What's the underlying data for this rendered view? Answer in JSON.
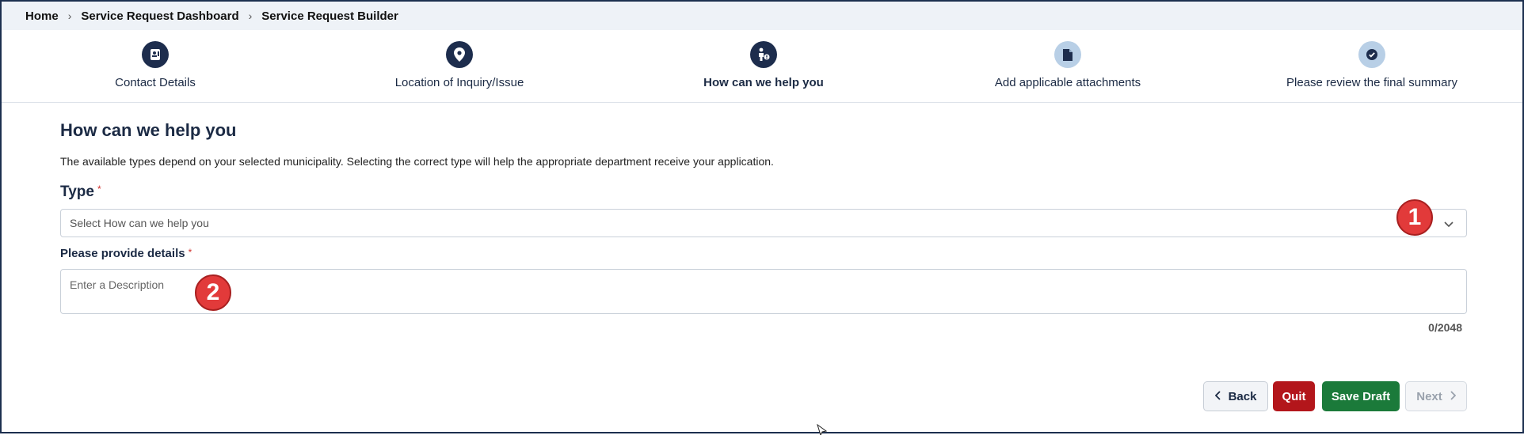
{
  "breadcrumb": {
    "items": [
      "Home",
      "Service Request Dashboard",
      "Service Request Builder"
    ]
  },
  "stepper": {
    "steps": [
      {
        "label": "Contact Details",
        "icon": "contact-card-icon",
        "state": "complete"
      },
      {
        "label": "Location of Inquiry/Issue",
        "icon": "map-pin-icon",
        "state": "complete"
      },
      {
        "label": "How can we help you",
        "icon": "person-help-icon",
        "state": "active"
      },
      {
        "label": "Add applicable attachments",
        "icon": "document-icon",
        "state": "pending"
      },
      {
        "label": "Please review the final summary",
        "icon": "check-circle-icon",
        "state": "pending"
      }
    ]
  },
  "form": {
    "heading": "How can we help you",
    "description": "The available types depend on your selected municipality. Selecting the correct type will help the appropriate department receive your application.",
    "type_label": "Type",
    "type_placeholder": "Select How can we help you",
    "details_label": "Please provide details",
    "details_placeholder": "Enter a Description",
    "required_mark": "*",
    "counter": "0/2048"
  },
  "markers": [
    "1",
    "2"
  ],
  "buttons": {
    "back": "Back",
    "quit": "Quit",
    "save_draft": "Save Draft",
    "next": "Next"
  },
  "colors": {
    "primary_dark": "#1d2d4d",
    "step_pending": "#b8cfe6",
    "quit": "#b3161b",
    "save": "#1b7a3a",
    "marker": "#e23a3a"
  }
}
